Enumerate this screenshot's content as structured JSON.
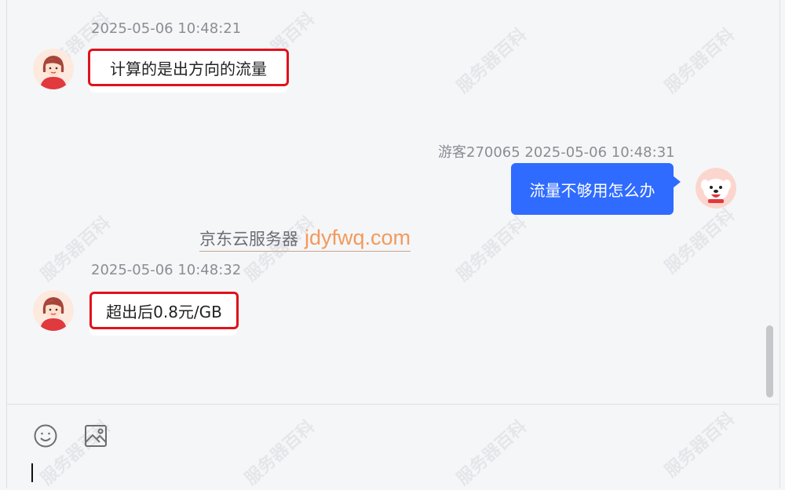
{
  "messages": [
    {
      "timestamp": "2025-05-06 10:48:21",
      "text": "计算的是出方向的流量"
    },
    {
      "sender_timestamp": "游客270065 2025-05-06 10:48:31",
      "text": "流量不够用怎么办"
    },
    {
      "timestamp": "2025-05-06 10:48:32",
      "text": "超出后0.8元/GB"
    }
  ],
  "brand": {
    "cn": "京东云服务器",
    "en": "jdyfwq.com"
  },
  "watermark": "服务器百科",
  "icons": {
    "emoji": "smile-icon",
    "image": "image-icon"
  },
  "colors": {
    "accent": "#2f6bff",
    "highlight": "#e0121b",
    "brand_orange": "#f29a5c"
  }
}
